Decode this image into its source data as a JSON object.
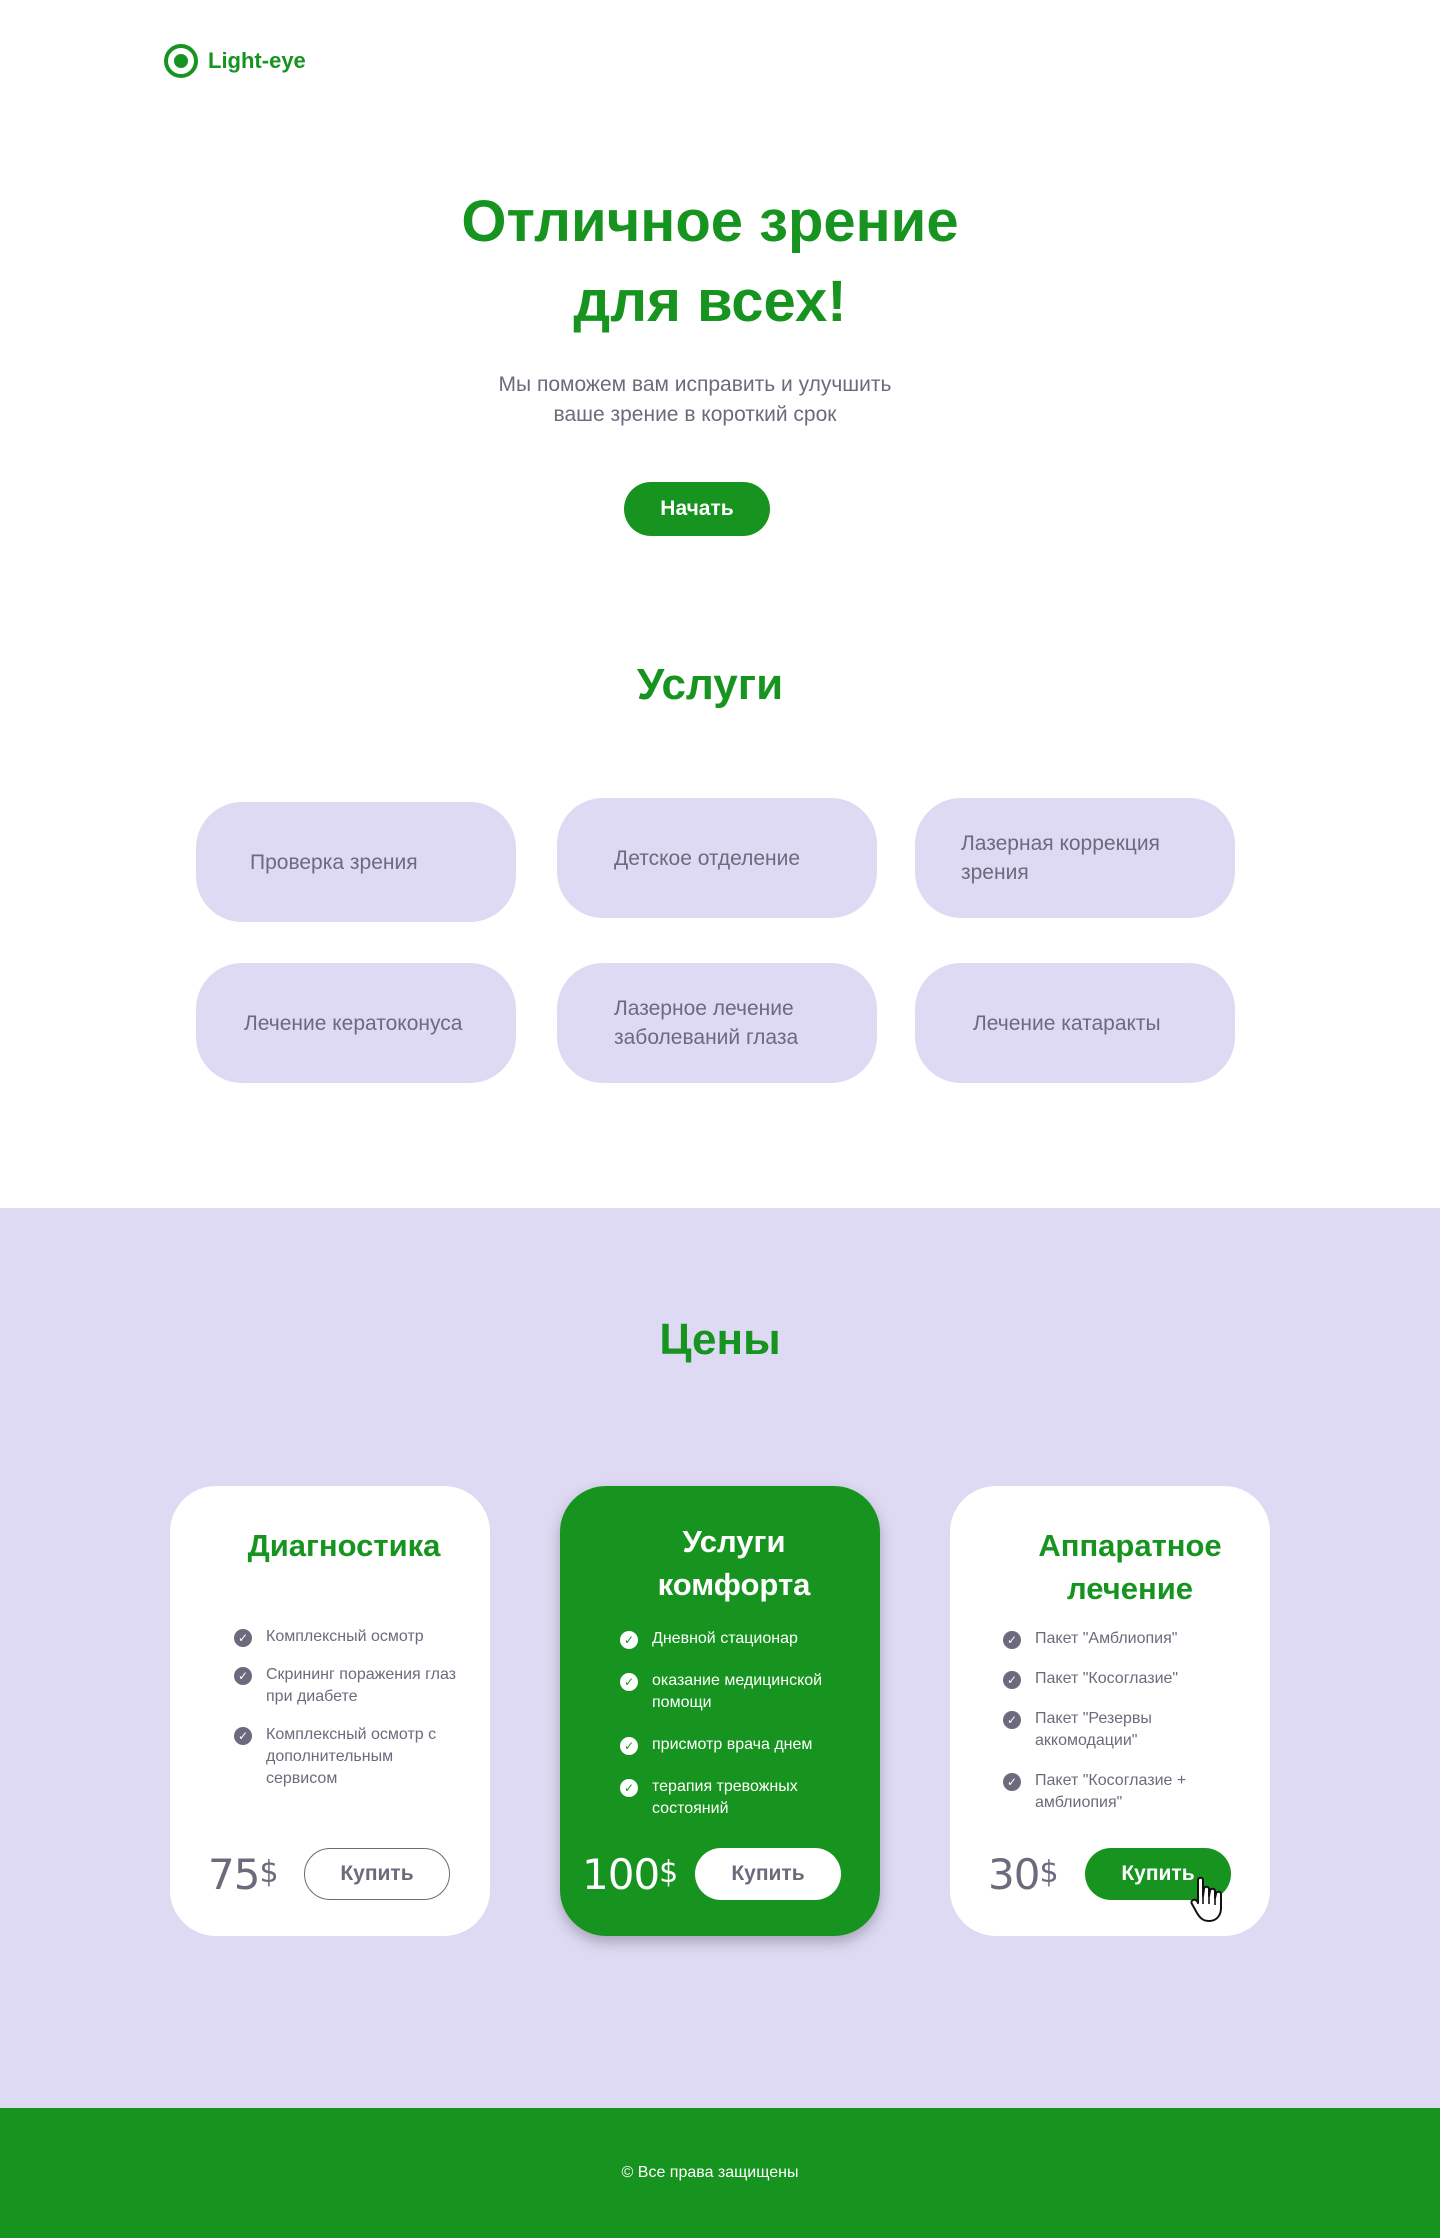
{
  "brand": {
    "logo_text": "Light-eye",
    "color": "#17941f",
    "logo_icon": "eye-circle-icon"
  },
  "hero": {
    "title_lines": [
      "Отличное зрение",
      "для всех!"
    ],
    "subtitle_lines": [
      "Мы поможем вам исправить и улучшить",
      "ваше зрение в короткий срок"
    ],
    "cta_label": "Начать"
  },
  "services": {
    "title": "Услуги",
    "items": [
      "Проверка зрения",
      "Детское отделение",
      "Лазерная коррекция зрения",
      "Лечение кератоконуса",
      "Лазерное лечение заболеваний глаза",
      "Лечение катаракты"
    ]
  },
  "prices": {
    "title": "Цены",
    "cards": [
      {
        "title_lines": [
          "Диагностика"
        ],
        "features": [
          "Комплексный осмотр",
          "Скрининг поражения глаз при диабете",
          "Комплексный осмотр с дополнительным сервисом"
        ],
        "price": "75",
        "currency": "$",
        "buy_label": "Купить"
      },
      {
        "title_lines": [
          "Услуги",
          "комфорта"
        ],
        "features": [
          "Дневной стационар",
          "оказание медицинской помощи",
          "присмотр врача днем",
          "терапия тревожных состояний"
        ],
        "price": "100",
        "currency": "$",
        "buy_label": "Купить"
      },
      {
        "title_lines": [
          "Аппаратное",
          "лечение"
        ],
        "features": [
          "Пакет \"Амблиопия\"",
          "Пакет \"Косоглазие\"",
          "Пакет \"Резервы аккомодации\"",
          "Пакет \"Косоглазие + амблиопия\""
        ],
        "price": "30",
        "currency": "$",
        "buy_label": "Купить"
      }
    ]
  },
  "footer": {
    "copyright": "© Все права защищены"
  },
  "colors": {
    "accent": "#17941f",
    "lavender": "#dedaf3",
    "text": "#6b6b7d"
  }
}
